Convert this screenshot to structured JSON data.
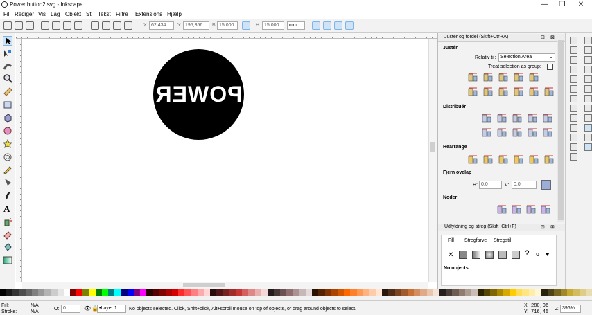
{
  "window": {
    "title": "Power button2.svg - Inkscape",
    "controls": [
      "—",
      "❐",
      "✕"
    ]
  },
  "menu": [
    "Fil",
    "Redigér",
    "Vis",
    "Lag",
    "Objekt",
    "Sti",
    "Tekst",
    "Filtre",
    "Extensions",
    "Hjælp"
  ],
  "controlbar": {
    "x_label": "X:",
    "x": "62,434",
    "y_label": "Y:",
    "y": "195,356",
    "w_label": "B:",
    "w": "15,000",
    "h_label": "H:",
    "h": "15,000",
    "unit": "mm"
  },
  "canvas": {
    "text": "POWER",
    "circle_color": "#000000"
  },
  "align_panel": {
    "title": "Justér og fordel (Skift+Ctrl+A)",
    "justify_heading": "Justér",
    "relative_label": "Relativ til:",
    "relative_value": "Selection Area",
    "treat_group": "Treat selection as group:",
    "distribute_heading": "Distribuér",
    "rearrange_heading": "Rearrange",
    "overlap_heading": "Fjern ovelap",
    "h_label": "H:",
    "h_value": "0,0",
    "v_label": "V:",
    "v_value": "0,0",
    "nodes_heading": "Noder"
  },
  "fill_panel": {
    "title": "Udfyldning og streg (Skift+Ctrl+F)",
    "tabs": [
      "Fill",
      "Stregfarve",
      "Stregstil"
    ],
    "no_objects": "No objects"
  },
  "statusbar": {
    "fill_label": "Fill:",
    "fill_value": "N/A",
    "stroke_label": "Stroke:",
    "stroke_value": "N/A",
    "opacity_label": "O:",
    "opacity_value": "0",
    "layer": "•Layer 1",
    "message": "No objects selected. Click, Shift+click, Alt+scroll mouse on top of objects, or drag around objects to select.",
    "x_label": "X:",
    "x_value": "280,06",
    "y_label": "Y:",
    "y_value": "716,45",
    "zoom_label": "Z:",
    "zoom_value": "396%"
  },
  "palette_colors": [
    "#000000",
    "#1a1a1a",
    "#333333",
    "#4d4d4d",
    "#666666",
    "#808080",
    "#999999",
    "#b3b3b3",
    "#cccccc",
    "#e6e6e6",
    "#ffffff",
    "#800000",
    "#ff0000",
    "#808000",
    "#ffff00",
    "#008000",
    "#00ff00",
    "#008080",
    "#00ffff",
    "#000080",
    "#0000ff",
    "#800080",
    "#ff00ff",
    "#2b0000",
    "#550000",
    "#800000",
    "#aa0000",
    "#d40000",
    "#ff2a2a",
    "#ff5555",
    "#ff8080",
    "#ffaaaa",
    "#ffd5d5",
    "#280b0b",
    "#501616",
    "#782121",
    "#a02c2c",
    "#c83737",
    "#d35f5f",
    "#de8787",
    "#e9afaf",
    "#f4d7d7",
    "#241c1c",
    "#483737",
    "#6c5353",
    "#916f6f",
    "#ac9393",
    "#c8b7b7",
    "#e3dbdb",
    "#2b1100",
    "#552200",
    "#803300",
    "#aa4400",
    "#d45500",
    "#ff6600",
    "#ff7f2a",
    "#ff9955",
    "#ffb380",
    "#ffccaa",
    "#ffe6d5",
    "#28170b",
    "#502d16",
    "#784421",
    "#a05a2c",
    "#c87137",
    "#d38d5f",
    "#deaa87",
    "#e9c6af",
    "#f4e3d7",
    "#241f1c",
    "#483e37",
    "#6c5d53",
    "#917c6f",
    "#ac9d93",
    "#c8beb7",
    "#2b2200",
    "#554400",
    "#806600",
    "#aa8800",
    "#d4aa00",
    "#ffcc00",
    "#ffdd55",
    "#ffe680",
    "#ffeeaa",
    "#fff6d5",
    "#28220b",
    "#504416",
    "#786721",
    "#a0892c",
    "#c8ab37",
    "#d3bc5f",
    "#decd87",
    "#e9ddaf"
  ]
}
